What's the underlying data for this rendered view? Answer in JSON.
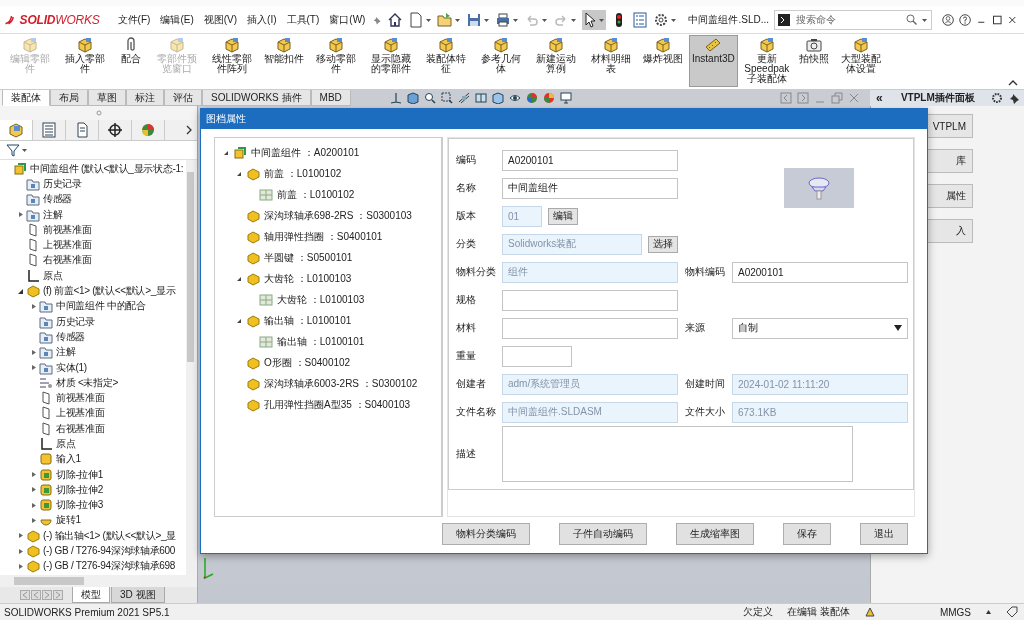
{
  "window": {
    "logo": "**SOLID**WORKS",
    "menus": [
      "文件(F)",
      "编辑(E)",
      "视图(V)",
      "插入(I)",
      "工具(T)",
      "窗口(W)"
    ],
    "selection_tool_active": true,
    "document_title": "中间盖组件.SLD...",
    "search": {
      "placeholder": "搜索命令"
    }
  },
  "ribbon": {
    "commands": [
      {
        "label": "编辑零部件",
        "disabled": true,
        "selected": false
      },
      {
        "label": "插入零部件",
        "disabled": false,
        "selected": false
      },
      {
        "label": "配合",
        "disabled": false,
        "selected": false
      },
      {
        "label": "零部件预览窗口",
        "disabled": true,
        "selected": false
      },
      {
        "label": "线性零部件阵列",
        "disabled": false,
        "selected": false
      },
      {
        "label": "智能扣件",
        "disabled": false,
        "selected": false
      },
      {
        "label": "移动零部件",
        "disabled": false,
        "selected": false
      },
      {
        "label": "显示隐藏的零部件",
        "disabled": false,
        "selected": false
      },
      {
        "label": "装配体特征",
        "disabled": false,
        "selected": false
      },
      {
        "label": "参考几何体",
        "disabled": false,
        "selected": false
      },
      {
        "label": "新建运动算例",
        "disabled": false,
        "selected": false
      },
      {
        "label": "材料明细表",
        "disabled": false,
        "selected": false
      },
      {
        "label": "爆炸视图",
        "disabled": false,
        "selected": false
      },
      {
        "label": "Instant3D",
        "disabled": false,
        "selected": true
      },
      {
        "label": "更新Speedpak子装配体",
        "disabled": false,
        "selected": false
      },
      {
        "label": "拍快照",
        "disabled": false,
        "selected": false
      },
      {
        "label": "大型装配体设置",
        "disabled": false,
        "selected": false
      }
    ],
    "tabs": [
      {
        "label": "装配体",
        "selected": true
      },
      {
        "label": "布局",
        "selected": false
      },
      {
        "label": "草图",
        "selected": false
      },
      {
        "label": "标注",
        "selected": false
      },
      {
        "label": "评估",
        "selected": false
      },
      {
        "label": "SOLIDWORKS 插件",
        "selected": false
      },
      {
        "label": "MBD",
        "selected": false
      }
    ]
  },
  "feature_tree": {
    "items": [
      {
        "label": "中间盖组件 (默认<默认_显示状态-1:",
        "kind": "assembly",
        "children": [
          {
            "label": "历史记录",
            "kind": "folder"
          },
          {
            "label": "传感器",
            "kind": "folder"
          },
          {
            "label": "注解",
            "kind": "folder",
            "expanded": false
          },
          {
            "label": "前视基准面",
            "kind": "plane"
          },
          {
            "label": "上视基准面",
            "kind": "plane"
          },
          {
            "label": "右视基准面",
            "kind": "plane"
          },
          {
            "label": "原点",
            "kind": "origin"
          },
          {
            "label": "(f) 前盖<1> (默认<<默认>_显示",
            "kind": "component",
            "expanded": true,
            "children": [
              {
                "label": "中间盖组件 中的配合",
                "kind": "folder",
                "expanded": false
              },
              {
                "label": "历史记录",
                "kind": "folder"
              },
              {
                "label": "传感器",
                "kind": "folder"
              },
              {
                "label": "注解",
                "kind": "folder",
                "expanded": false
              },
              {
                "label": "实体(1)",
                "kind": "folder",
                "expanded": false
              },
              {
                "label": "材质 <未指定>",
                "kind": "material"
              },
              {
                "label": "前视基准面",
                "kind": "plane"
              },
              {
                "label": "上视基准面",
                "kind": "plane"
              },
              {
                "label": "右视基准面",
                "kind": "plane"
              },
              {
                "label": "原点",
                "kind": "origin"
              },
              {
                "label": "输入1",
                "kind": "feature"
              },
              {
                "label": "切除-拉伸1",
                "kind": "cut",
                "expanded": false
              },
              {
                "label": "切除-拉伸2",
                "kind": "cut",
                "expanded": false
              },
              {
                "label": "切除-拉伸3",
                "kind": "cut",
                "expanded": false
              },
              {
                "label": "旋转1",
                "kind": "revolve",
                "expanded": false
              }
            ]
          },
          {
            "label": "(-) 输出轴<1> (默认<<默认>_显",
            "kind": "component",
            "expanded": false
          },
          {
            "label": "(-) GB / T276-94深沟球轴承600",
            "kind": "component",
            "expanded": false
          },
          {
            "label": "(-) GB / T276-94深沟球轴承698",
            "kind": "component",
            "expanded": false
          }
        ]
      }
    ]
  },
  "bottom_tabs": [
    {
      "label": "模型",
      "selected": true
    },
    {
      "label": "3D 视图",
      "selected": false
    }
  ],
  "dialog": {
    "title": "图档属性",
    "tree": [
      {
        "label": "中间盖组件 ：A0200101",
        "kind": "assembly",
        "expanded": true,
        "children": [
          {
            "label": "前盖 ：L0100102",
            "kind": "component",
            "expanded": true,
            "children": [
              {
                "label": "前盖 ：L0100102",
                "kind": "sheet"
              }
            ]
          },
          {
            "label": "深沟球轴承698-2RS ：S0300103",
            "kind": "component"
          },
          {
            "label": "轴用弹性挡圈 ：S0400101",
            "kind": "component"
          },
          {
            "label": "半圆键 ：S0500101",
            "kind": "component"
          },
          {
            "label": "大齿轮 ：L0100103",
            "kind": "component",
            "expanded": true,
            "children": [
              {
                "label": "大齿轮 ：L0100103",
                "kind": "sheet"
              }
            ]
          },
          {
            "label": "输出轴 ：L0100101",
            "kind": "component",
            "expanded": true,
            "children": [
              {
                "label": "输出轴 ：L0100101",
                "kind": "sheet"
              }
            ]
          },
          {
            "label": "O形圈 ：S0400102",
            "kind": "component"
          },
          {
            "label": "深沟球轴承6003-2RS ：S0300102",
            "kind": "component"
          },
          {
            "label": "孔用弹性挡圈A型35 ：S0400103",
            "kind": "component"
          }
        ]
      }
    ],
    "form": [
      {
        "fields": [
          {
            "label": "编码",
            "kind": "text",
            "value": "A0200101",
            "readonly": false
          }
        ]
      },
      {
        "fields": [
          {
            "label": "名称",
            "kind": "text",
            "value": "中间盖组件",
            "readonly": false
          }
        ]
      },
      {
        "fields": [
          {
            "label": "版本",
            "kind": "tiny",
            "value": "01",
            "readonly": true,
            "button": "编辑"
          }
        ]
      },
      {
        "fields": [
          {
            "label": "分类",
            "kind": "mid",
            "value": "Solidworks装配",
            "readonly": true,
            "button": "选择"
          }
        ]
      },
      {
        "fields": [
          {
            "label": "物料分类",
            "kind": "text",
            "value": "组件",
            "readonly": true
          },
          {
            "label": "物料编码",
            "kind": "text",
            "value": "A0200101",
            "readonly": false
          }
        ]
      },
      {
        "fields": [
          {
            "label": "规格",
            "kind": "text",
            "readonly": false
          }
        ]
      },
      {
        "fields": [
          {
            "label": "材料",
            "kind": "text",
            "readonly": false
          },
          {
            "label": "来源",
            "kind": "select",
            "value": "自制",
            "readonly": false
          }
        ]
      },
      {
        "fields": [
          {
            "label": "重量",
            "kind": "short",
            "readonly": false
          }
        ]
      },
      {
        "fields": [
          {
            "label": "创建者",
            "kind": "text",
            "value": "adm/系统管理员",
            "readonly": true
          },
          {
            "label": "创建时间",
            "kind": "text",
            "value": "2024-01-02 11:11:20",
            "readonly": true
          }
        ]
      },
      {
        "fields": [
          {
            "label": "文件名称",
            "kind": "text",
            "value": "中间盖组件.SLDASM",
            "readonly": true
          },
          {
            "label": "文件大小",
            "kind": "text",
            "value": "673.1KB",
            "readonly": true
          }
        ]
      },
      {
        "fields": [
          {
            "label": "描述",
            "kind": "textarea",
            "readonly": false
          }
        ]
      }
    ],
    "buttons": [
      "物料分类编码",
      "子件自动编码",
      "生成缩率图",
      "保存",
      "退出"
    ]
  },
  "task_pane": {
    "collapse": "«",
    "title": "VTPLM插件面板",
    "buttons": [
      "VTPLM",
      "库",
      "属性",
      "入"
    ]
  },
  "status_bar": {
    "product": "SOLIDWORKS Premium 2021 SP5.1",
    "state": "欠定义",
    "mode": "在编辑 装配体",
    "units": "MMGS"
  }
}
